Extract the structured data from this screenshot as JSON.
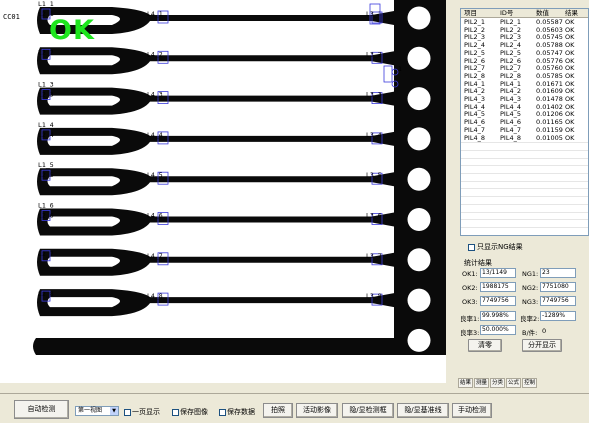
{
  "view": {
    "camera_label": "CC01",
    "result_text": "OK",
    "colors": {
      "part": "#0a0a0a",
      "frame": "#ffffff",
      "roi": "#3b3bdc",
      "ok": "#1ee61e"
    },
    "left_labels": [
      [
        "L1_1",
        "L2_1"
      ],
      [
        "L2_2"
      ],
      [
        "L1_3",
        "L2_3"
      ],
      [
        "L1_4",
        "L2_4"
      ],
      [
        "L1_5",
        "L2_5"
      ],
      [
        "L1_6",
        "L2_6"
      ],
      [
        "L2_7"
      ],
      [
        "L2_8"
      ]
    ],
    "mid_labels": [
      "L4_1",
      "L4_2",
      "L4_3",
      "L4_4",
      "L4_5",
      "L4_6",
      "L4_7",
      "L4_8"
    ],
    "right_labels": [
      "L3_1",
      "L3_2",
      "L3_3",
      "L3_4",
      "L3_5",
      "L3_6",
      "L3_7",
      "L3_8"
    ],
    "extra_right_label": "1"
  },
  "results": {
    "headers": [
      "项目",
      "ID号",
      "数值",
      "结果"
    ],
    "rows": [
      [
        "PIL2_1",
        "PIL2_1",
        "0.05587",
        "OK"
      ],
      [
        "PIL2_2",
        "PIL2_2",
        "0.05603",
        "OK"
      ],
      [
        "PIL2_3",
        "PIL2_3",
        "0.05745",
        "OK"
      ],
      [
        "PIL2_4",
        "PIL2_4",
        "0.05788",
        "OK"
      ],
      [
        "PIL2_5",
        "PIL2_5",
        "0.05747",
        "OK"
      ],
      [
        "PIL2_6",
        "PIL2_6",
        "0.05776",
        "OK"
      ],
      [
        "PIL2_7",
        "PIL2_7",
        "0.05760",
        "OK"
      ],
      [
        "PIL2_8",
        "PIL2_8",
        "0.05785",
        "OK"
      ],
      [
        "PIL4_1",
        "PIL4_1",
        "0.01671",
        "OK"
      ],
      [
        "PIL4_2",
        "PIL4_2",
        "0.01609",
        "OK"
      ],
      [
        "PIL4_3",
        "PIL4_3",
        "0.01478",
        "OK"
      ],
      [
        "PIL4_4",
        "PIL4_4",
        "0.01402",
        "OK"
      ],
      [
        "PIL4_5",
        "PIL4_5",
        "0.01206",
        "OK"
      ],
      [
        "PIL4_6",
        "PIL4_6",
        "0.01165",
        "OK"
      ],
      [
        "PIL4_7",
        "PIL4_7",
        "0.01159",
        "OK"
      ],
      [
        "PIL4_8",
        "PIL4_8",
        "0.01005",
        "OK"
      ]
    ]
  },
  "ng_only_label": "只显示NG结果",
  "stats": {
    "title": "统计结果",
    "ok1_label": "OK1:",
    "ok1_value": "13/1149",
    "ng1_label": "NG1:",
    "ng1_value": "23",
    "ok2_label": "OK2:",
    "ok2_value": "1988175",
    "ng2_label": "NG2:",
    "ng2_value": "7751080",
    "ok3_label": "OK3:",
    "ok3_value": "7749756",
    "ng3_label": "NG3:",
    "ng3_value": "7749756",
    "rate1_label": "良率1:",
    "rate1_value": "99.998%",
    "rate2_label": "良率2:",
    "rate2_value": "-1289%",
    "rate3_label": "良率3:",
    "rate3_value": "50.000%",
    "bj_label": "B/件:",
    "bj_value": "0",
    "clear_button": "清零",
    "split_button": "分开显示"
  },
  "panel_tabs": [
    "结果",
    "测量",
    "分类",
    "公式",
    "控制"
  ],
  "toolbar": {
    "auto_detect": "自动检测",
    "view_select": "第一视图",
    "one_page_label": "一页显示",
    "save_image_label": "保存图像",
    "save_data_label": "保存数据",
    "capture": "拍照",
    "live": "活动影像",
    "hide_roi": "隐/显检测框",
    "hide_baseline": "隐/显基准线",
    "manual_detect": "手动检测"
  }
}
